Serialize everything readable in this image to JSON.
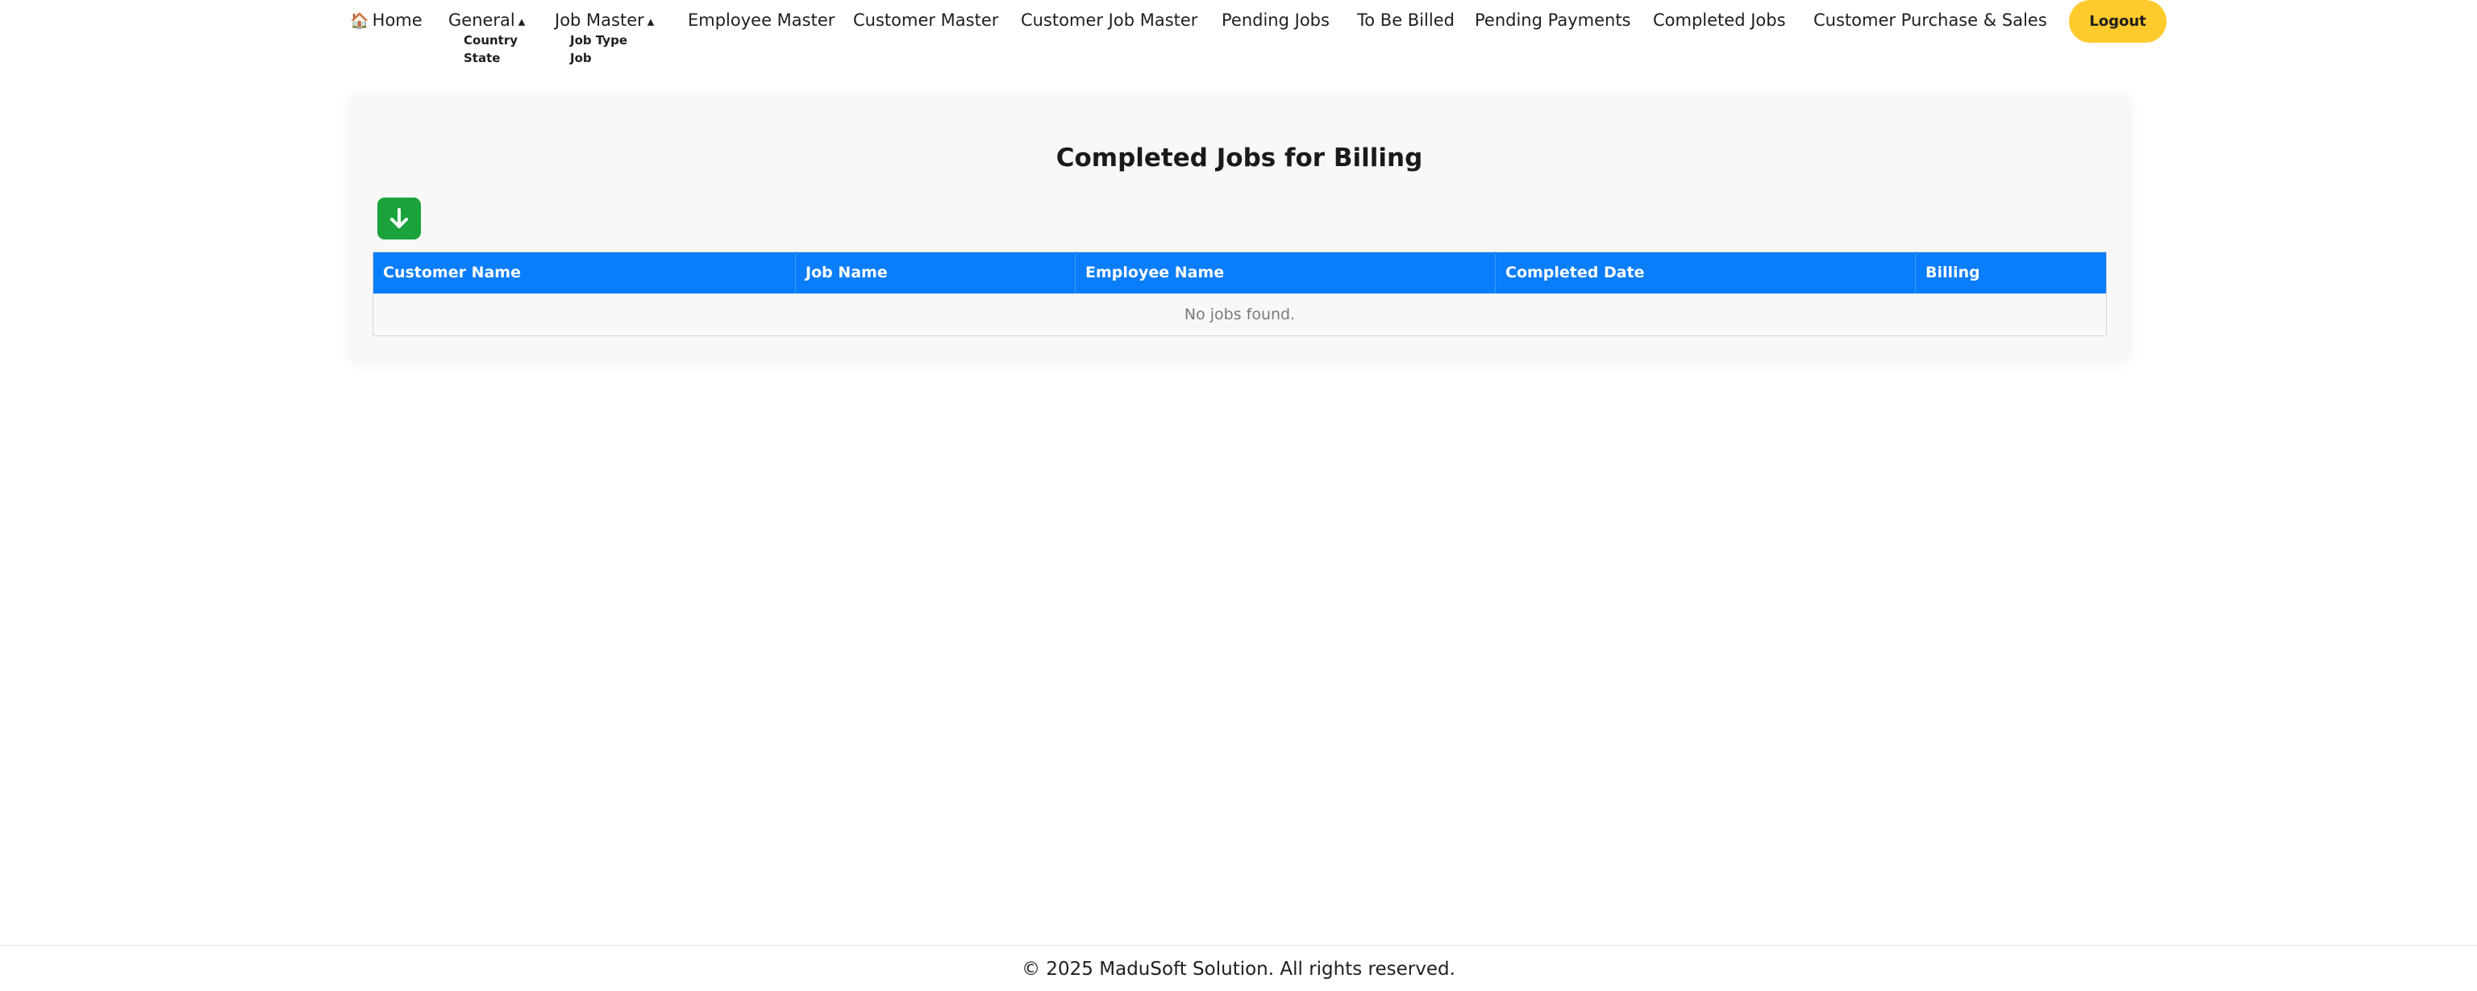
{
  "nav": {
    "home_icon": "🏠",
    "home": "Home",
    "general": "General",
    "general_caret": "▴",
    "general_sub": [
      "Country",
      "State"
    ],
    "job_master": "Job Master",
    "job_master_caret": "▴",
    "job_master_sub": [
      "Job Type",
      "Job"
    ],
    "employee_master": "Employee Master",
    "customer_master": "Customer Master",
    "customer_job_master": "Customer Job Master",
    "pending_jobs": "Pending Jobs",
    "to_be_billed": "To Be Billed",
    "pending_payments": "Pending Payments",
    "completed_jobs": "Completed Jobs",
    "customer_purchase_sales": "Customer Purchase & Sales",
    "logout": "Logout"
  },
  "main": {
    "title": "Completed Jobs for Billing",
    "download_icon": "download-arrow-icon",
    "table": {
      "columns": [
        "Customer Name",
        "Job Name",
        "Employee Name",
        "Completed Date",
        "Billing"
      ],
      "empty_message": "No jobs found."
    }
  },
  "footer": {
    "text": "© 2025 MaduSoft Solution. All rights reserved."
  },
  "colors": {
    "accent": "#0a7dfa",
    "logout": "#ffca2c",
    "download": "#1aa33b"
  }
}
